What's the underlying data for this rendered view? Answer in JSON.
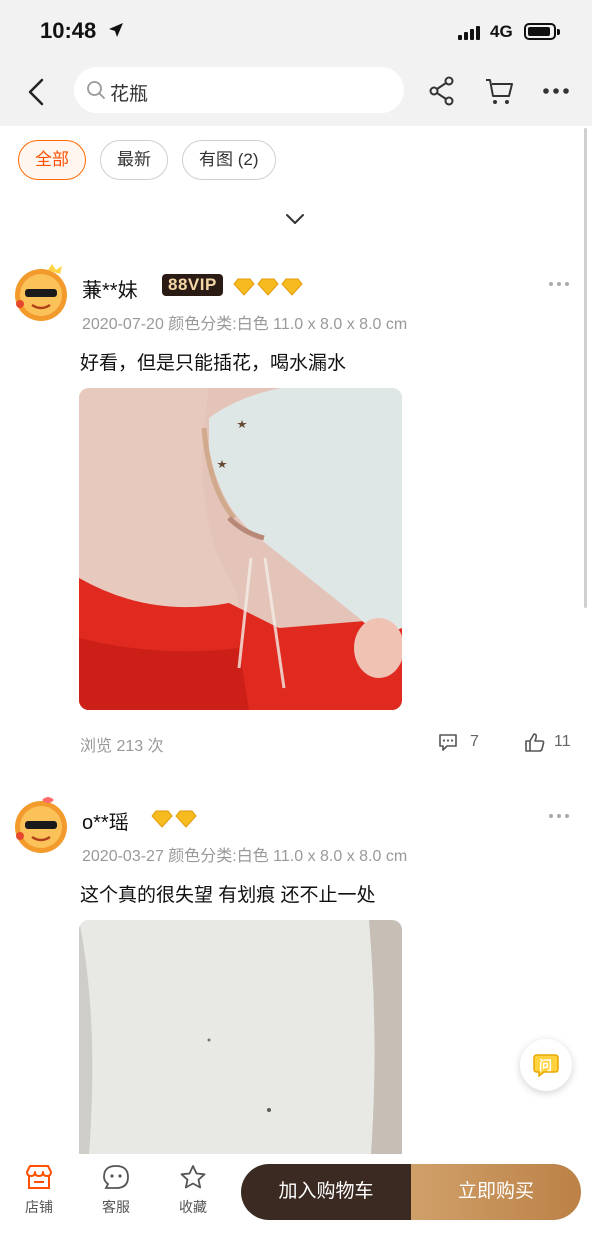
{
  "status": {
    "time": "10:48",
    "network": "4G"
  },
  "nav": {
    "search_text": "花瓶"
  },
  "filters": [
    {
      "label": "全部",
      "active": true
    },
    {
      "label": "最新",
      "active": false
    },
    {
      "label": "有图 (2)",
      "active": false
    }
  ],
  "reviews": [
    {
      "username": "蒹**妹",
      "vip": "88VIP",
      "crowns": 3,
      "meta": "2020-07-20 颜色分类:白色 11.0 x 8.0 x 8.0 cm",
      "text": "好看，但是只能插花，喝水漏水",
      "views": "浏览 213 次",
      "comments": "7",
      "likes": "11"
    },
    {
      "username": "o**瑶",
      "crowns": 2,
      "meta": "2020-03-27 颜色分类:白色 11.0 x 8.0 x 8.0 cm",
      "text": "这个真的很失望 有划痕 还不止一处"
    }
  ],
  "float_ask": "问",
  "bottom": {
    "shop": "店铺",
    "service": "客服",
    "favorite": "收藏",
    "add_to_cart": "加入购物车",
    "buy_now": "立即购买"
  },
  "colors": {
    "accent": "#ff5000",
    "cart_btn": "#3a2a22",
    "buy_btn": "#c79356"
  }
}
